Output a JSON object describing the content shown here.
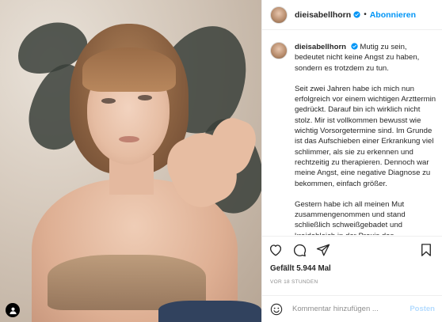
{
  "post": {
    "username": "dieisabellhorn",
    "follow_label": "Abonnieren",
    "separator": "•",
    "caption_lead": "Mutig zu sein, bedeutet nicht keine Angst zu haben, sondern es trotzdem zu tun.",
    "caption_p2": "Seit zwei Jahren habe ich mich nun erfolgreich vor einem wichtigen Arzttermin gedrückt. Darauf bin ich wirklich nicht stolz. Mir ist vollkommen bewusst wie wichtig Vorsorgetermine sind. Im Grunde ist das Aufschieben einer Erkrankung viel schlimmer, als sie zu erkennen und rechtzeitig zu therapieren. Dennoch war meine Angst, eine negative Diagnose zu bekommen, einfach größer.",
    "caption_p3": "Gestern habe ich all meinen Mut zusammengenommen und stand schließlich schweißgebadet und kreidebleich in der Praxis des Brustzentrums. In meiner Brust wurde ein gutartiger Tumor",
    "likes": "Gefällt 5.944 Mal",
    "time": "VOR 18 STUNDEN"
  },
  "comment": {
    "placeholder": "Kommentar hinzufügen ...",
    "post_label": "Posten"
  },
  "icons": {
    "like": "heart-icon",
    "comment": "comment-icon",
    "share": "share-icon",
    "save": "bookmark-icon",
    "emoji": "emoji-icon",
    "tag": "user-tag-icon",
    "verified": "verified-badge-icon"
  },
  "colors": {
    "accent": "#0095f6",
    "post_disabled": "#b3dbff",
    "muted": "#8e8e8e"
  }
}
